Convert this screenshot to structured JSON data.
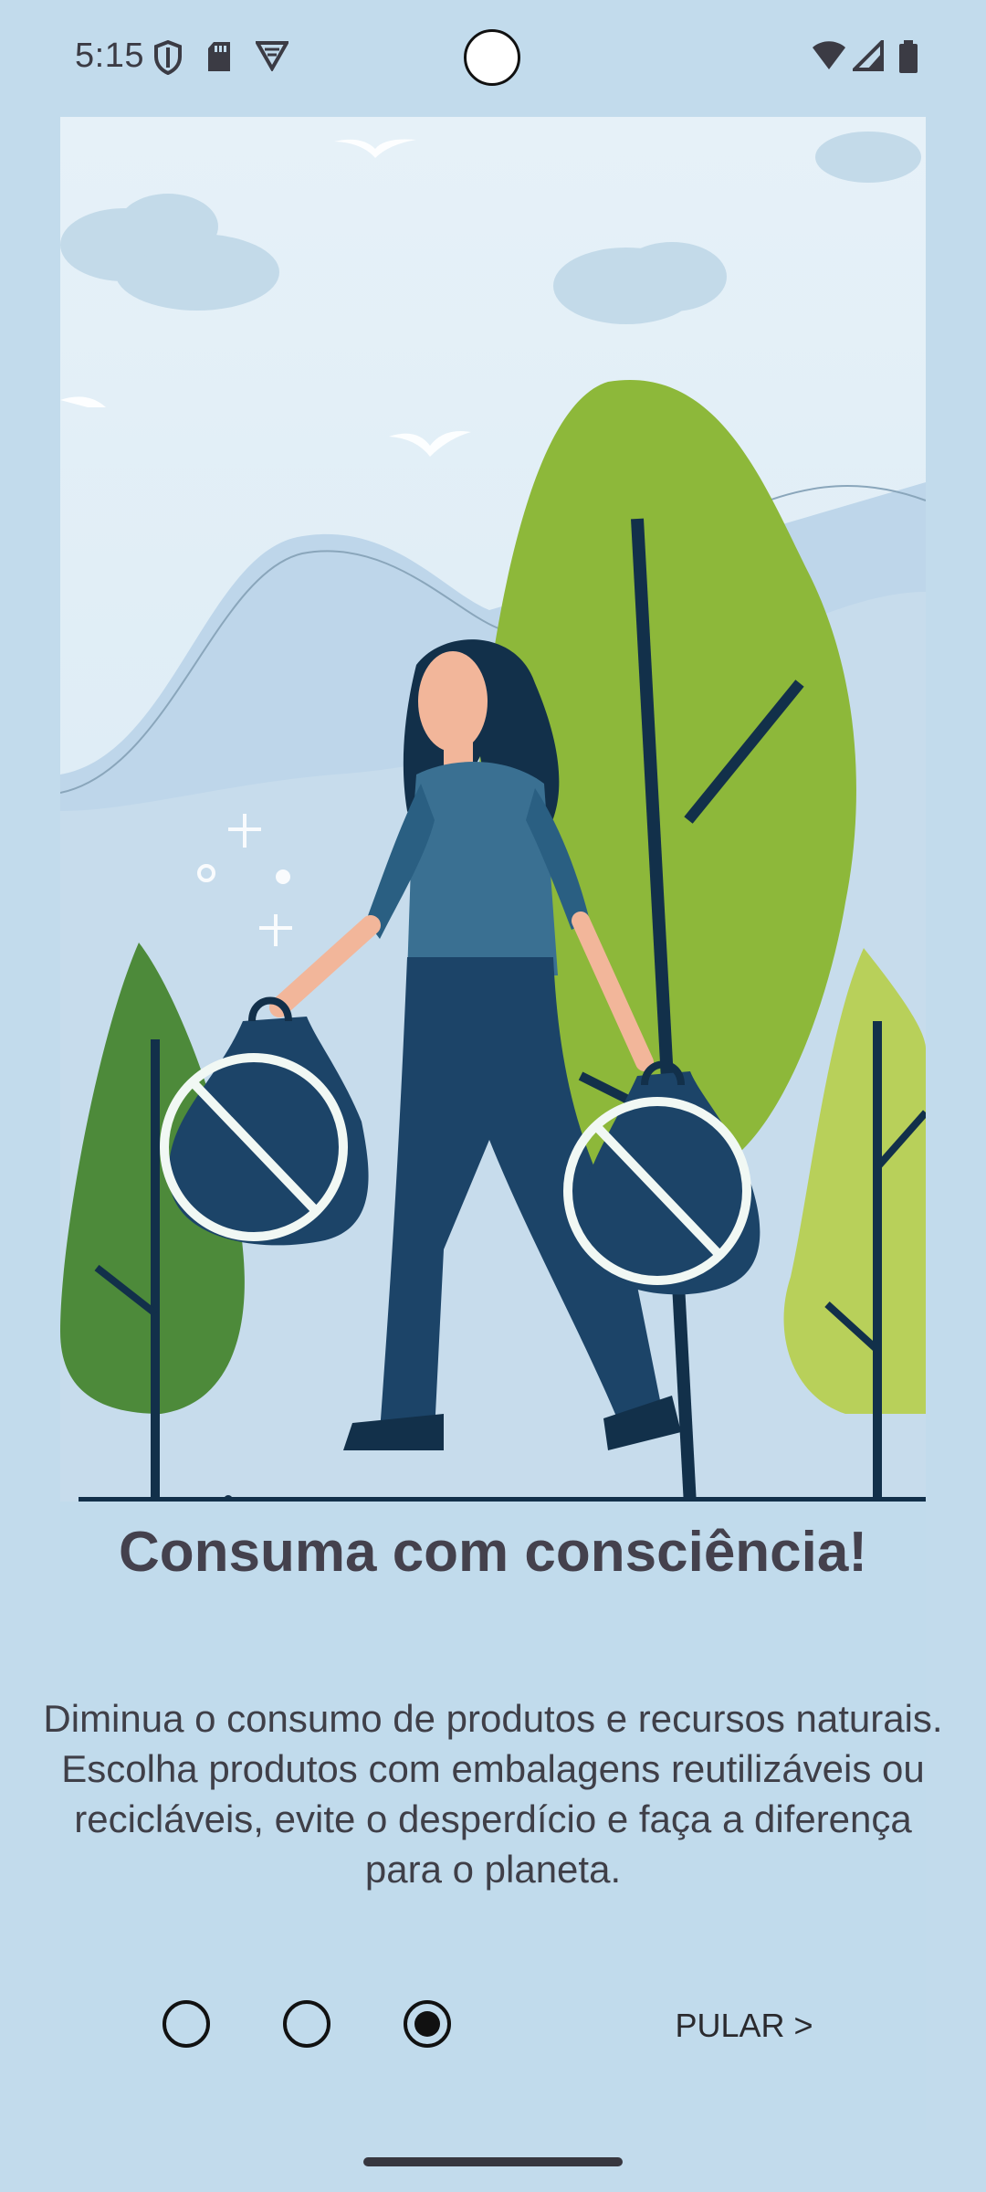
{
  "status_bar": {
    "time": "5:15",
    "left_icons": [
      "shield-icon",
      "sd-card-icon",
      "vpn-icon"
    ],
    "right_icons": [
      "wifi-icon",
      "cellular-signal-icon",
      "battery-icon"
    ]
  },
  "illustration": {
    "description_icons": [
      "no-plastic-bag-icon"
    ]
  },
  "onboarding": {
    "title": "Consuma com consciência!",
    "description": "Diminua o consumo de produtos e recursos naturais. Escolha produtos com embalagens reutilizáveis ou recicláveis, evite o desperdício e faça a diferença para o planeta.",
    "page_count": 3,
    "current_page": 3,
    "skip_label": "PULAR >"
  },
  "colors": {
    "background": "#c2dbec",
    "title": "#44414d",
    "text": "#3f3f48",
    "tree_green": "#8db83a",
    "tree_dark_green": "#4d8a3a",
    "tree_light_green": "#b8d05a",
    "figure_navy": "#1c4468"
  }
}
